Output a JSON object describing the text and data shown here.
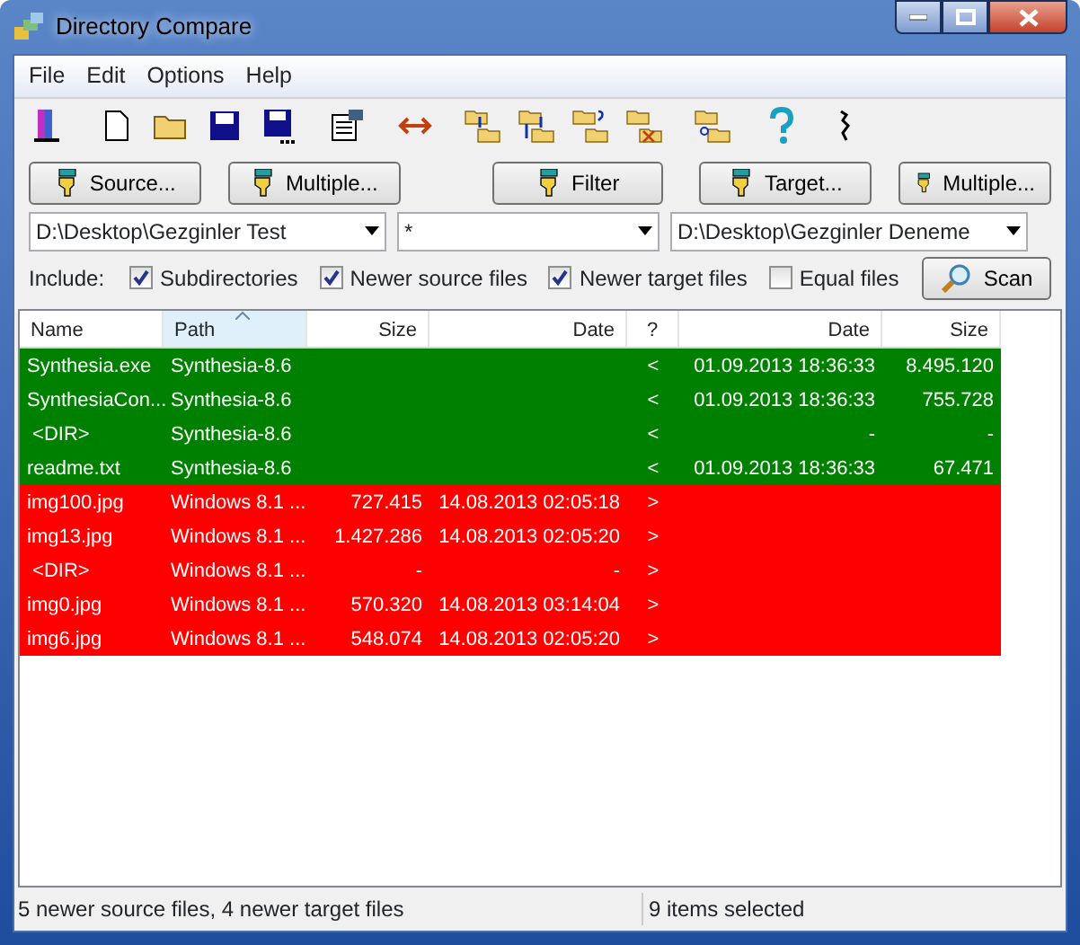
{
  "window": {
    "title": "Directory Compare"
  },
  "menu": [
    "File",
    "Edit",
    "Options",
    "Help"
  ],
  "buttons": {
    "source": "Source...",
    "source_multiple": "Multiple...",
    "filter": "Filter",
    "target": "Target...",
    "target_multiple": "Multiple..."
  },
  "paths": {
    "source": "D:\\Desktop\\Gezginler Test",
    "filter": "*",
    "target": "D:\\Desktop\\Gezginler Deneme"
  },
  "include": {
    "label": "Include:",
    "options": [
      {
        "label": "Subdirectories",
        "checked": true
      },
      {
        "label": "Newer source files",
        "checked": true
      },
      {
        "label": "Newer target files",
        "checked": true
      },
      {
        "label": "Equal files",
        "checked": false
      }
    ]
  },
  "scan_button": "Scan",
  "table": {
    "columns": [
      {
        "label": "Name",
        "sorted": false
      },
      {
        "label": "Path",
        "sorted": true
      },
      {
        "label": "Size",
        "sorted": false
      },
      {
        "label": "Date",
        "sorted": false
      },
      {
        "label": "?",
        "sorted": false
      },
      {
        "label": "Date",
        "sorted": false
      },
      {
        "label": "Size",
        "sorted": false
      }
    ],
    "rows": [
      {
        "color": "#008000",
        "name": "Synthesia.exe",
        "path": "Synthesia-8.6",
        "direction": "<",
        "target_date": "01.09.2013 18:36:33",
        "target_size": "8.495.120"
      },
      {
        "color": "#008000",
        "name": "SynthesiaCon...",
        "path": "Synthesia-8.6",
        "direction": "<",
        "target_date": "01.09.2013 18:36:33",
        "target_size": "755.728"
      },
      {
        "color": "#008000",
        "name": " <DIR>",
        "path": "Synthesia-8.6",
        "direction": "<",
        "target_date": "-",
        "target_size": "-"
      },
      {
        "color": "#008000",
        "name": "readme.txt",
        "path": "Synthesia-8.6",
        "direction": "<",
        "target_date": "01.09.2013 18:36:33",
        "target_size": "67.471"
      },
      {
        "color": "#ff0000",
        "name": "img100.jpg",
        "path": "Windows 8.1 ...",
        "size": "727.415",
        "date": "14.08.2013 02:05:18",
        "direction": ">"
      },
      {
        "color": "#ff0000",
        "name": "img13.jpg",
        "path": "Windows 8.1 ...",
        "size": "1.427.286",
        "date": "14.08.2013 02:05:20",
        "direction": ">"
      },
      {
        "color": "#ff0000",
        "name": " <DIR>",
        "path": "Windows 8.1 ...",
        "size": "-",
        "date": "-",
        "direction": ">"
      },
      {
        "color": "#ff0000",
        "name": "img0.jpg",
        "path": "Windows 8.1 ...",
        "size": "570.320",
        "date": "14.08.2013 03:14:04",
        "direction": ">"
      },
      {
        "color": "#ff0000",
        "name": "img6.jpg",
        "path": "Windows 8.1 ...",
        "size": "548.074",
        "date": "14.08.2013 02:05:20",
        "direction": ">"
      }
    ]
  },
  "status_bar": [
    "5 newer source files, 4 newer target files",
    "9 items selected"
  ]
}
